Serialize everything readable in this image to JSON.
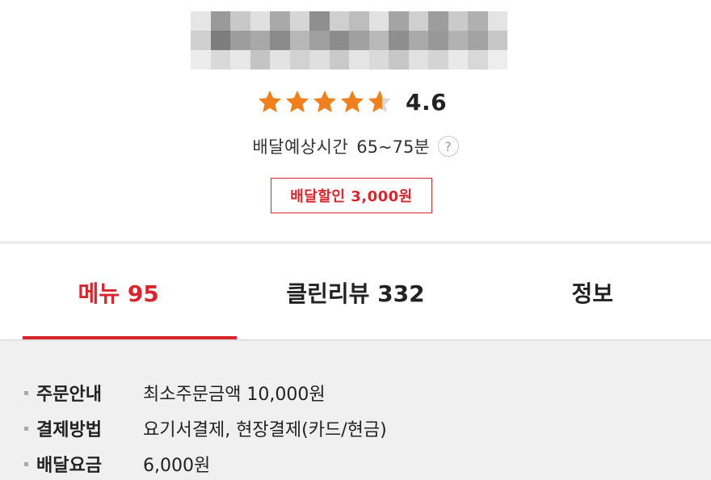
{
  "store": {
    "rating": 4.6,
    "rating_text": "4.6",
    "star_color": "#f0801e",
    "star_empty_color": "#d8d8d8"
  },
  "delivery": {
    "time_label": "배달예상시간",
    "time_value": "65~75분",
    "help_icon": "question-icon",
    "help_glyph": "?"
  },
  "discount": {
    "badge_text": "배달할인 3,000원",
    "color": "#d9262e"
  },
  "tabs": [
    {
      "label": "메뉴 95",
      "active": true
    },
    {
      "label": "클린리뷰 332",
      "active": false
    },
    {
      "label": "정보",
      "active": false
    }
  ],
  "info": [
    {
      "label": "주문안내",
      "value": "최소주문금액 10,000원"
    },
    {
      "label": "결제방법",
      "value": "요기서결제, 현장결제(카드/현금)"
    },
    {
      "label": "배달요금",
      "value": "6,000원"
    }
  ],
  "accent_color": "#d9262e"
}
